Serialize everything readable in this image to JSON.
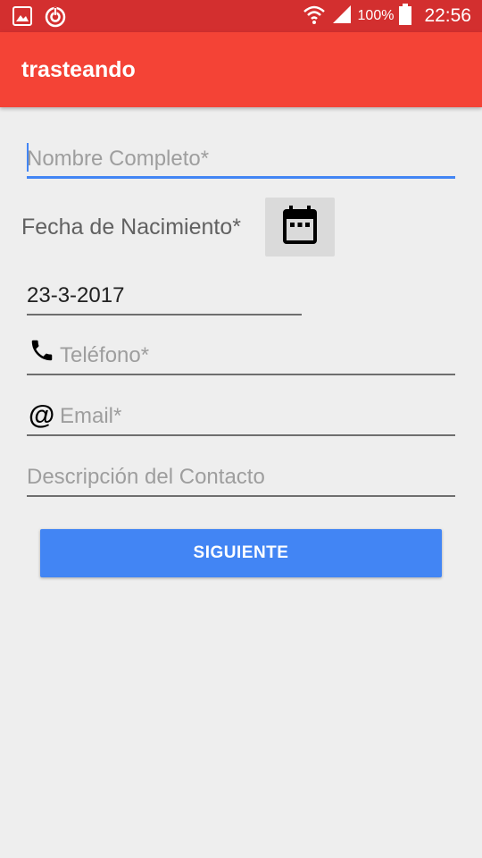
{
  "status_bar": {
    "battery_percent": "100%",
    "time": "22:56",
    "icons": [
      "gallery-icon",
      "sync-icon",
      "wifi-icon",
      "signal-icon",
      "battery-icon"
    ]
  },
  "app_bar": {
    "title": "trasteando"
  },
  "form": {
    "nombre": {
      "placeholder": "Nombre Completo*",
      "value": ""
    },
    "fecha_label": "Fecha de Nacimiento*",
    "fecha_value": "23-3-2017",
    "telefono": {
      "placeholder": "Teléfono*",
      "icon": "phone-icon"
    },
    "email": {
      "placeholder": "Email*",
      "icon": "at-icon",
      "icon_glyph": "@"
    },
    "descripcion": {
      "placeholder": "Descripción del Contacto"
    },
    "siguiente_label": "SIGUIENTE"
  },
  "colors": {
    "status_bar": "#d32f2f",
    "app_bar": "#f44336",
    "accent": "#4285f4",
    "background": "#eeeeee"
  }
}
